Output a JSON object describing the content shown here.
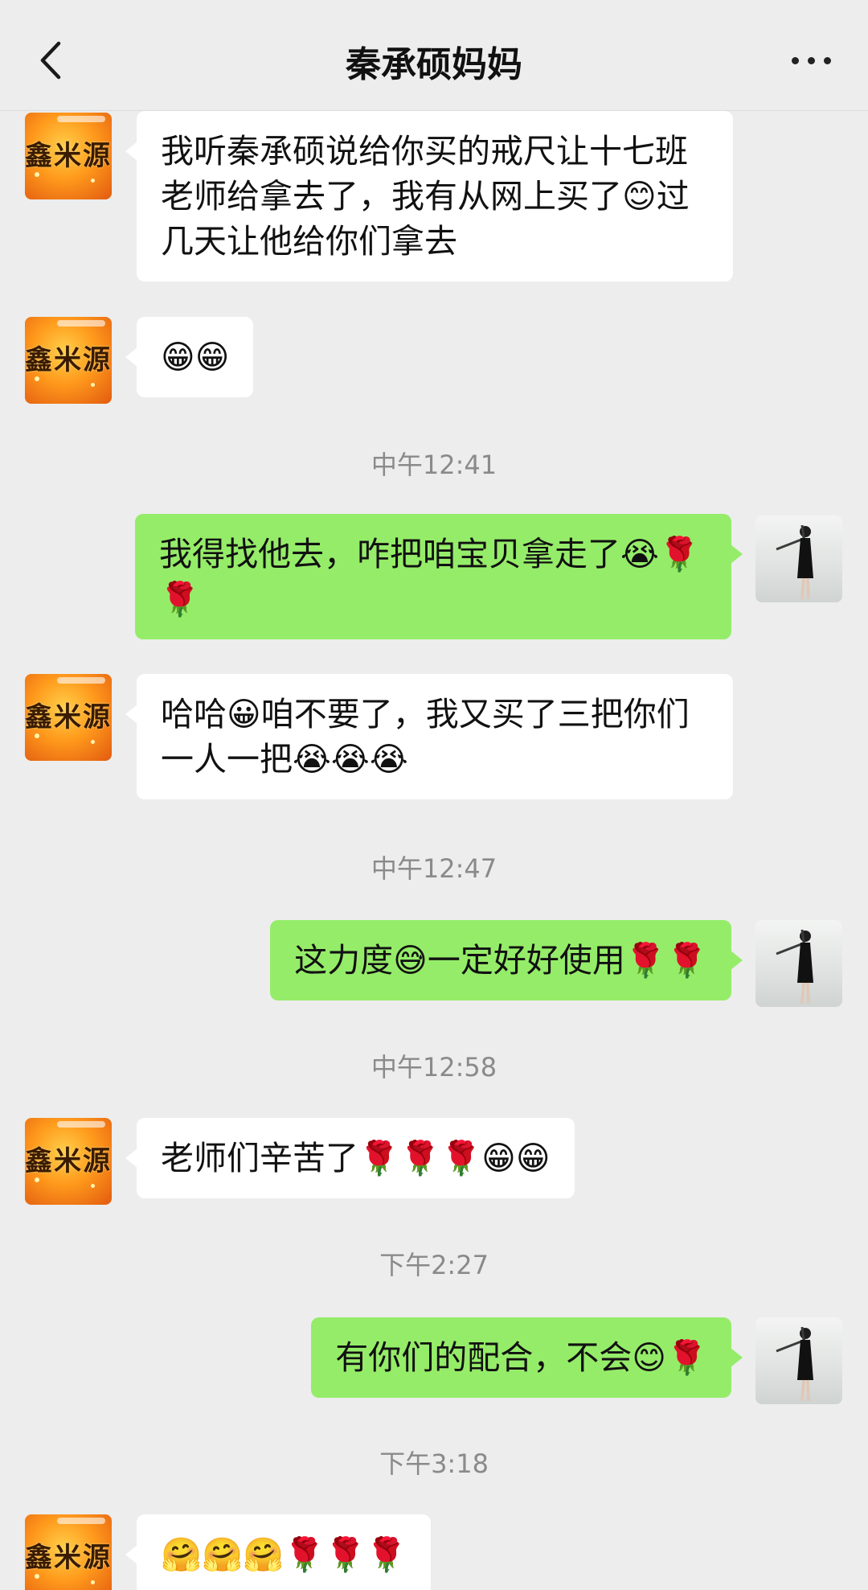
{
  "header": {
    "title": "秦承硕妈妈",
    "back_icon": "chevron-left-icon",
    "more_icon": "more-dots-icon"
  },
  "avatars": {
    "mom_logo_text": "鑫米源",
    "me": "ballet-dancer-photo"
  },
  "messages": [
    {
      "type": "in",
      "text": "我听秦承硕说给你买的戒尺让十七班老师给拿去了，我有从网上买了😊过几天让他给你们拿去"
    },
    {
      "type": "in",
      "text": "😁😁"
    },
    {
      "type": "time",
      "text": "中午12:41"
    },
    {
      "type": "out",
      "text": "我得找他去，咋把咱宝贝拿走了😭🌹🌹"
    },
    {
      "type": "in",
      "text": "哈哈😀咱不要了，我又买了三把你们一人一把😭😭😭"
    },
    {
      "type": "time",
      "text": "中午12:47"
    },
    {
      "type": "out",
      "text": "这力度😅一定好好使用🌹🌹"
    },
    {
      "type": "time",
      "text": "中午12:58"
    },
    {
      "type": "in",
      "text": "老师们辛苦了🌹🌹🌹😁😁"
    },
    {
      "type": "time",
      "text": "下午2:27"
    },
    {
      "type": "out",
      "text": "有你们的配合，不会😊🌹"
    },
    {
      "type": "time",
      "text": "下午3:18"
    },
    {
      "type": "in",
      "text": "🤗🤗🤗🌹🌹🌹"
    }
  ]
}
